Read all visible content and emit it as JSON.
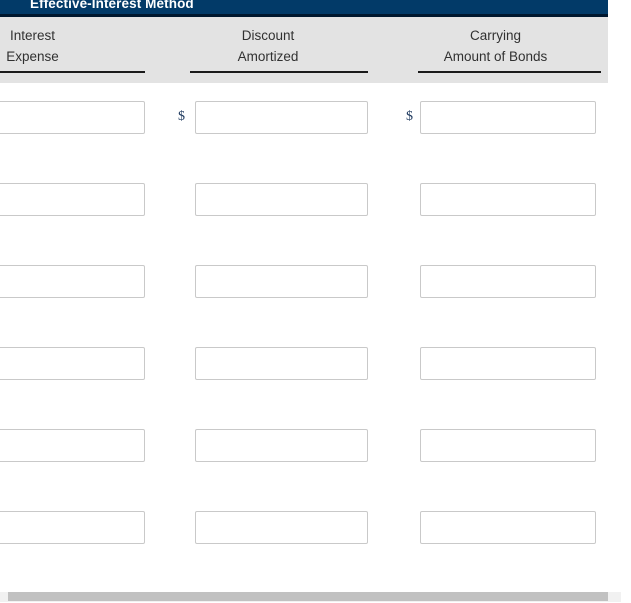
{
  "window": {
    "title": "Effective-Interest Method",
    "background_color": "#ffffff"
  },
  "theme": {
    "header_bar_color": "#023a68",
    "header_rule_color": "#00172e",
    "header_band_color": "#e3e3e3",
    "column_rule_color": "#1a1a1a",
    "input_border_color": "#c9c9c9",
    "text_color": "#313131",
    "dollar_color": "#1f3a5f",
    "scrollbar_thumb_color": "#c1c1c1",
    "scrollbar_track_color": "#f1f1f1"
  },
  "table": {
    "columns": [
      {
        "id": "interest-expense",
        "line1": "Interest",
        "line2": "Expense"
      },
      {
        "id": "discount-amortized",
        "line1": "Discount",
        "line2": "Amortized"
      },
      {
        "id": "carrying-amount",
        "line1": "Carrying",
        "line2": "Amount of Bonds"
      }
    ],
    "currency_symbol": "$",
    "rows": [
      {
        "index": 1,
        "show_currency": true,
        "cells": [
          {
            "column": "interest-expense",
            "value": "",
            "placeholder": ""
          },
          {
            "column": "discount-amortized",
            "value": "",
            "placeholder": ""
          },
          {
            "column": "carrying-amount",
            "value": "",
            "placeholder": ""
          }
        ]
      },
      {
        "index": 2,
        "show_currency": false,
        "cells": [
          {
            "column": "interest-expense",
            "value": "",
            "placeholder": ""
          },
          {
            "column": "discount-amortized",
            "value": "",
            "placeholder": ""
          },
          {
            "column": "carrying-amount",
            "value": "",
            "placeholder": ""
          }
        ]
      },
      {
        "index": 3,
        "show_currency": false,
        "cells": [
          {
            "column": "interest-expense",
            "value": "",
            "placeholder": ""
          },
          {
            "column": "discount-amortized",
            "value": "",
            "placeholder": ""
          },
          {
            "column": "carrying-amount",
            "value": "",
            "placeholder": ""
          }
        ]
      },
      {
        "index": 4,
        "show_currency": false,
        "cells": [
          {
            "column": "interest-expense",
            "value": "",
            "placeholder": ""
          },
          {
            "column": "discount-amortized",
            "value": "",
            "placeholder": ""
          },
          {
            "column": "carrying-amount",
            "value": "",
            "placeholder": ""
          }
        ]
      },
      {
        "index": 5,
        "show_currency": false,
        "cells": [
          {
            "column": "interest-expense",
            "value": "",
            "placeholder": ""
          },
          {
            "column": "discount-amortized",
            "value": "",
            "placeholder": ""
          },
          {
            "column": "carrying-amount",
            "value": "",
            "placeholder": ""
          }
        ]
      },
      {
        "index": 6,
        "show_currency": false,
        "cells": [
          {
            "column": "interest-expense",
            "value": "",
            "placeholder": ""
          },
          {
            "column": "discount-amortized",
            "value": "",
            "placeholder": ""
          },
          {
            "column": "carrying-amount",
            "value": "",
            "placeholder": ""
          }
        ]
      }
    ]
  },
  "scrollbar": {
    "orientation": "horizontal",
    "thumb_label": ""
  }
}
